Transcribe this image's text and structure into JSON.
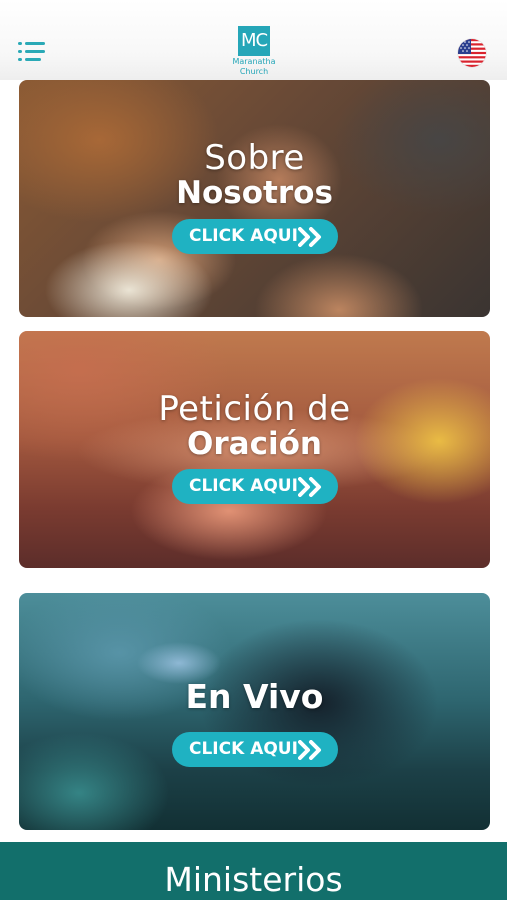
{
  "header": {
    "menu_icon": "hamburger-menu-icon",
    "logo": {
      "letters": "MC",
      "name_line1": "Maranatha",
      "name_line2": "Church"
    },
    "language_icon": "us-flag-icon"
  },
  "cards": [
    {
      "title_line1": "Sobre",
      "title_line2": "Nosotros",
      "cta": "CLICK AQUI"
    },
    {
      "title_line1": "Petición de",
      "title_line2": "Oración",
      "cta": "CLICK AQUI"
    },
    {
      "title_line1": "",
      "title_line2": "En Vivo",
      "cta": "CLICK AQUI"
    }
  ],
  "footer": {
    "title": "Ministerios"
  },
  "colors": {
    "accent": "#1fb2c2",
    "footer_bg": "#126f6b"
  }
}
